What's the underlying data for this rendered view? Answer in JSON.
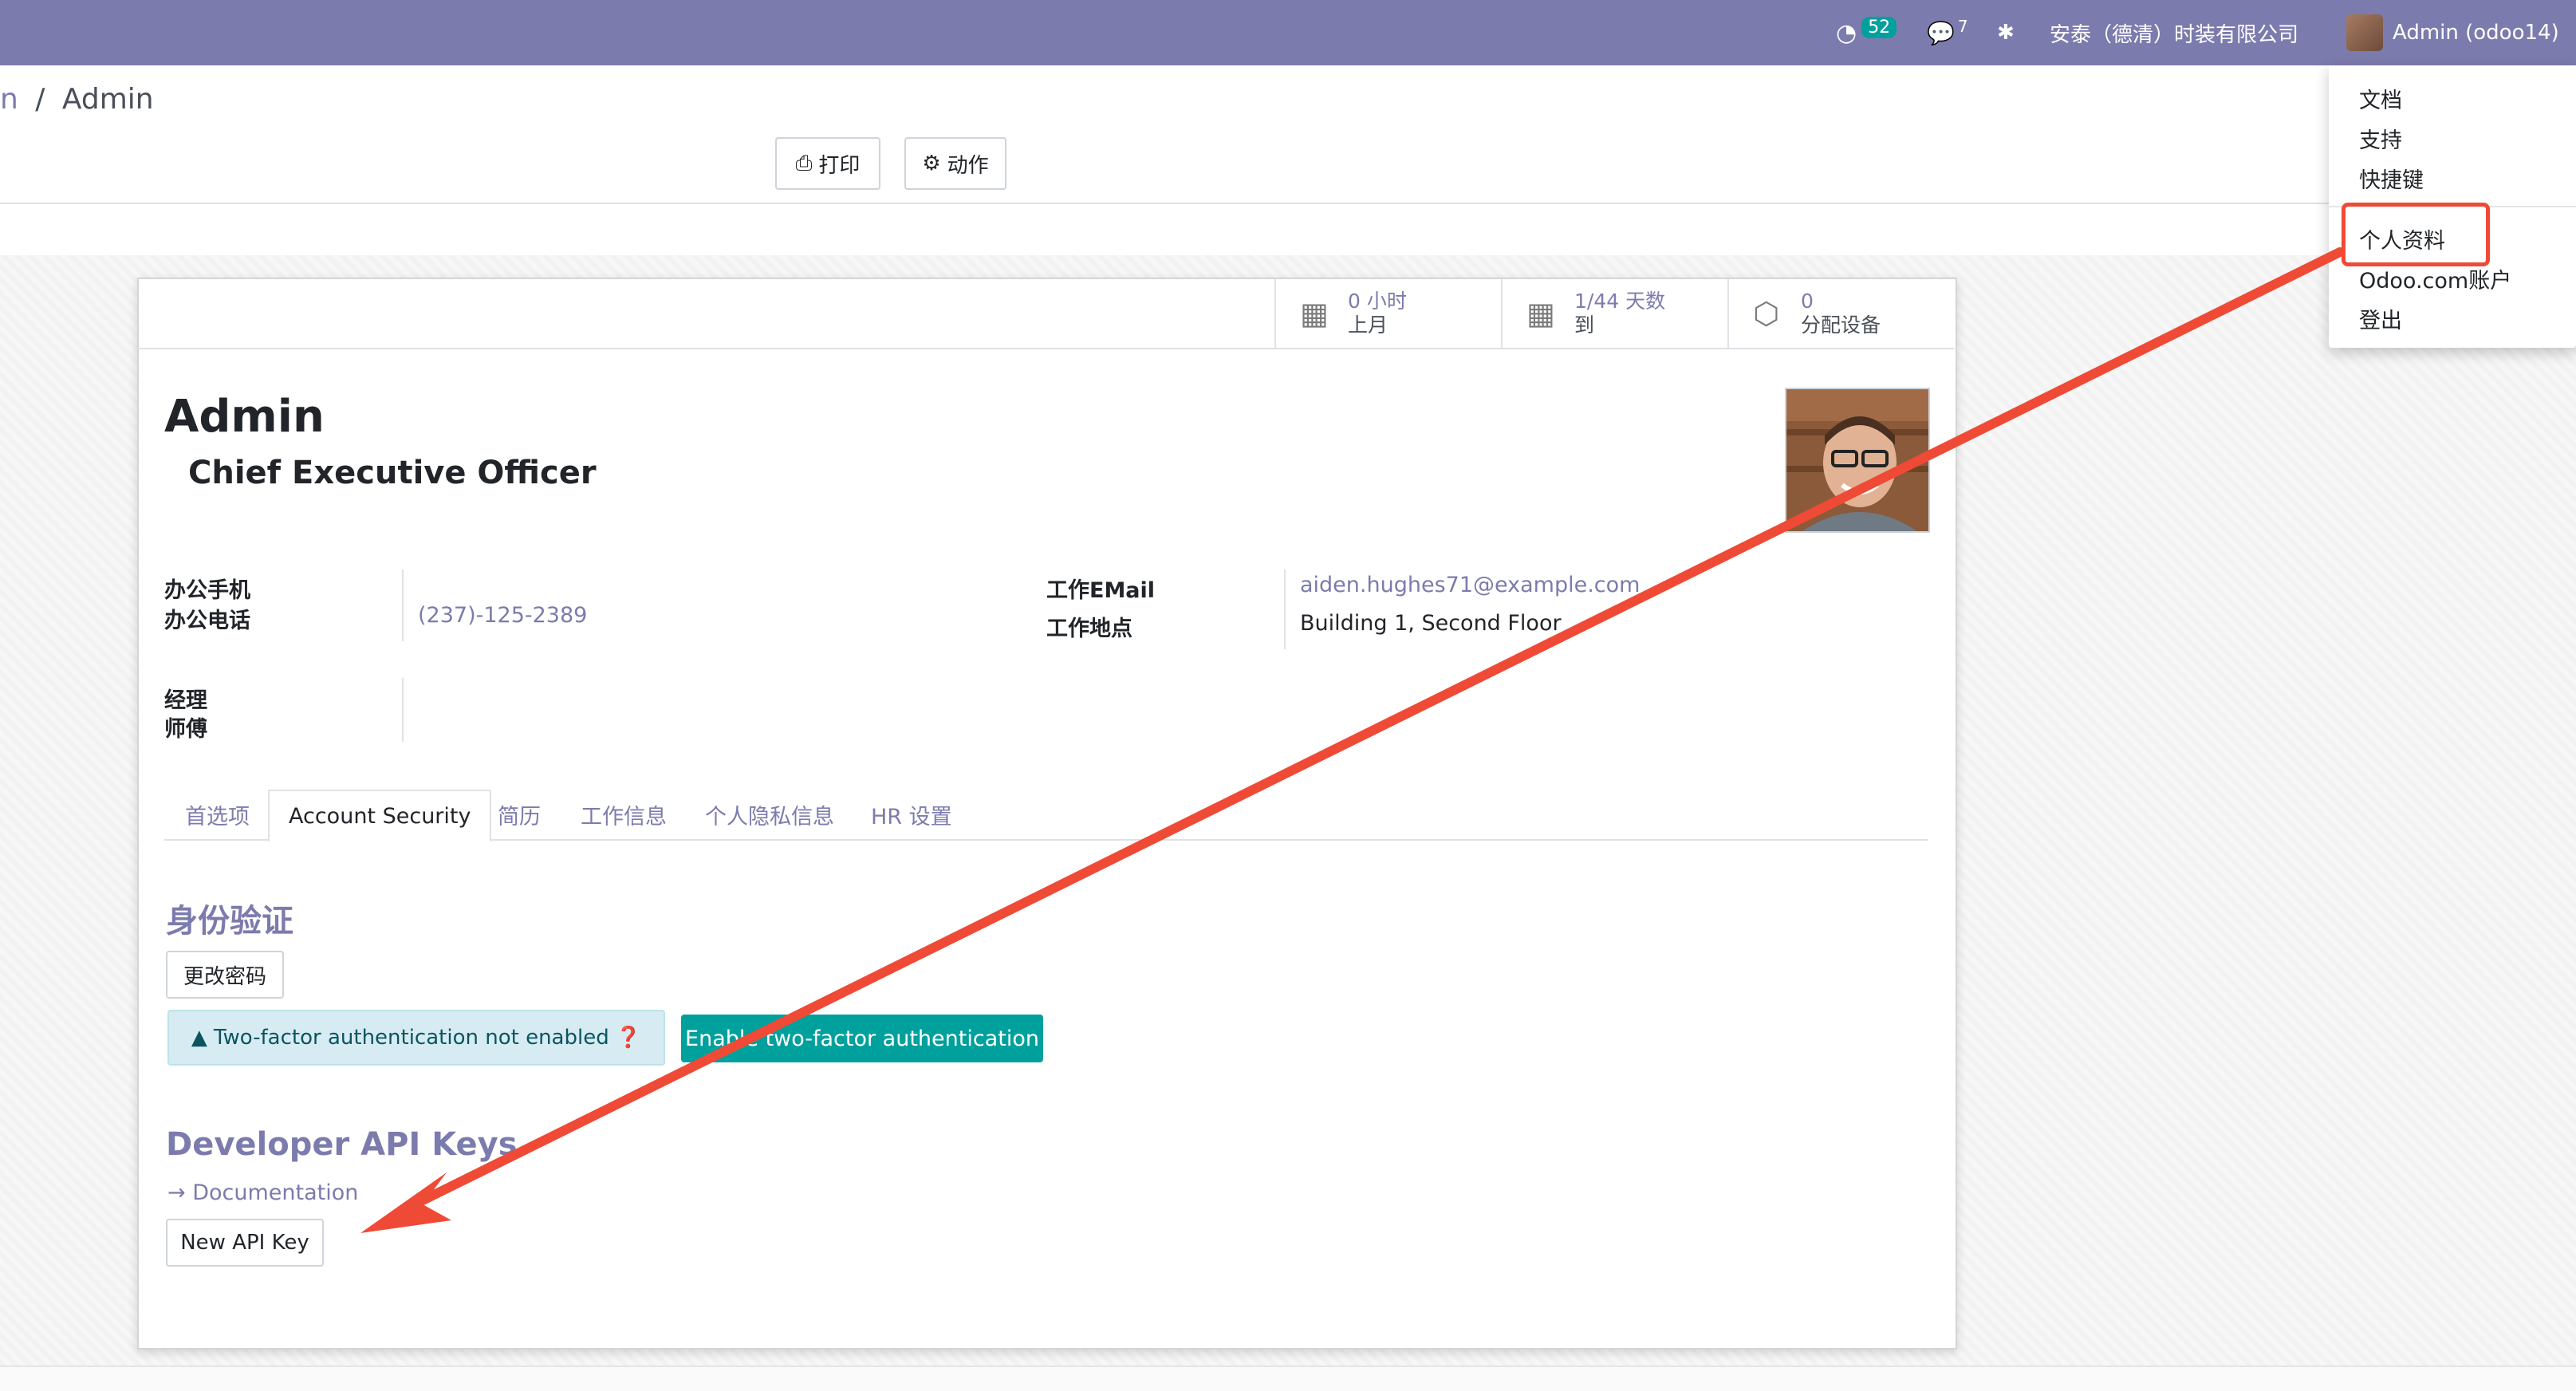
{
  "navbar": {
    "activity_count": "52",
    "message_count": "7",
    "company_name": "安泰（德清）时装有限公司",
    "user_label": "Admin (odoo14)",
    "icons": [
      "clock-icon",
      "chat-icon",
      "bug-icon"
    ]
  },
  "breadcrumb": {
    "parent": "n",
    "separator": "/",
    "current": "Admin"
  },
  "toolbar": {
    "print_label": "打印",
    "action_label": "动作"
  },
  "stat_buttons": [
    {
      "value": "0 小时",
      "label": "上月"
    },
    {
      "value": "1/44 天数",
      "label": "到"
    },
    {
      "value": "0",
      "label": "分配设备"
    }
  ],
  "employee": {
    "name": "Admin",
    "job_title": "Chief Executive Officer",
    "mobile_label": "办公手机",
    "phone_label": "办公电话",
    "phone_value": "(237)-125-2389",
    "email_label": "工作EMail",
    "email_value": "aiden.hughes71@example.com",
    "location_label": "工作地点",
    "location_value": "Building 1, Second Floor",
    "manager_label": "经理",
    "coach_label": "师傅"
  },
  "tabs": [
    {
      "label": "首选项"
    },
    {
      "label": "Account Security"
    },
    {
      "label": "简历"
    },
    {
      "label": "工作信息"
    },
    {
      "label": "个人隐私信息"
    },
    {
      "label": "HR 设置"
    }
  ],
  "security": {
    "auth_title": "身份验证",
    "change_password": "更改密码",
    "tfa_alert": "Two-factor authentication not enabled",
    "enable_tfa": "Enable two-factor authentication",
    "api_title": "Developer API Keys",
    "documentation": "Documentation",
    "new_api_key": "New API Key"
  },
  "user_menu": {
    "items": [
      "文档",
      "支持",
      "快捷键",
      "个人资料",
      "Odoo.com账户",
      "登出"
    ]
  },
  "colors": {
    "navbar": "#7c7bad",
    "teal": "#00a09d",
    "annotation": "#ef4a36"
  }
}
